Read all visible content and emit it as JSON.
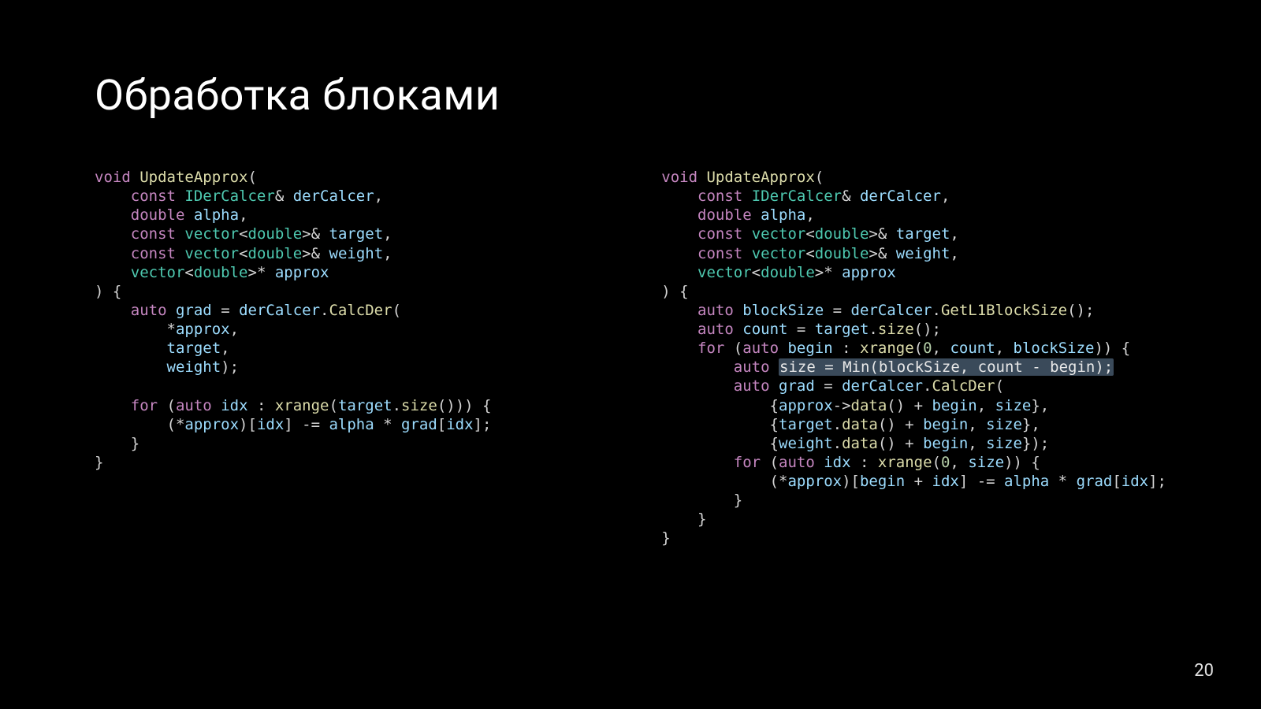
{
  "slide": {
    "title": "Обработка блоками",
    "page_number": "20"
  },
  "code_left": {
    "l1": {
      "kw_void": "void",
      "fn": "UpdateApprox",
      "p": "("
    },
    "l2": {
      "kw_const": "const",
      "type": "IDerCalcer",
      "amp": "&",
      "var": "derCalcer",
      "comma": ","
    },
    "l3": {
      "kw_double": "double",
      "var": "alpha",
      "comma": ","
    },
    "l4": {
      "kw_const": "const",
      "type": "vector",
      "lt": "<",
      "tp": "double",
      "gt": ">",
      "amp": "&",
      "var": "target",
      "comma": ","
    },
    "l5": {
      "kw_const": "const",
      "type": "vector",
      "lt": "<",
      "tp": "double",
      "gt": ">",
      "amp": "&",
      "var": "weight",
      "comma": ","
    },
    "l6": {
      "type": "vector",
      "lt": "<",
      "tp": "double",
      "gt": ">",
      "star": "*",
      "var": "approx"
    },
    "l7": {
      "txt": ") {"
    },
    "l8": {
      "kw_auto": "auto",
      "var": "grad",
      "eq": " = ",
      "obj": "derCalcer",
      "dot": ".",
      "fn": "CalcDer",
      "p": "("
    },
    "l9": {
      "star": "*",
      "var": "approx",
      "comma": ","
    },
    "l10": {
      "var": "target",
      "comma": ","
    },
    "l11": {
      "var": "weight",
      "p": ");"
    },
    "l12": {
      "txt": ""
    },
    "l13": {
      "kw_for": "for",
      "p1": " (",
      "kw_auto": "auto",
      "var": "idx",
      "colon": " : ",
      "fn": "xrange",
      "p2": "(",
      "obj": "target",
      "dot": ".",
      "fn2": "size",
      "p3": "())) {"
    },
    "l14": {
      "p1": "(*",
      "var1": "approx",
      "p2": ")[",
      "var2": "idx",
      "p3": "] -= ",
      "var3": "alpha",
      "p4": " * ",
      "var4": "grad",
      "p5": "[",
      "var5": "idx",
      "p6": "];"
    },
    "l15": {
      "txt": "}"
    },
    "l16": {
      "txt": "}"
    }
  },
  "code_right": {
    "l1": {
      "kw_void": "void",
      "fn": "UpdateApprox",
      "p": "("
    },
    "l2": {
      "kw_const": "const",
      "type": "IDerCalcer",
      "amp": "&",
      "var": "derCalcer",
      "comma": ","
    },
    "l3": {
      "kw_double": "double",
      "var": "alpha",
      "comma": ","
    },
    "l4": {
      "kw_const": "const",
      "type": "vector",
      "lt": "<",
      "tp": "double",
      "gt": ">",
      "amp": "&",
      "var": "target",
      "comma": ","
    },
    "l5": {
      "kw_const": "const",
      "type": "vector",
      "lt": "<",
      "tp": "double",
      "gt": ">",
      "amp": "&",
      "var": "weight",
      "comma": ","
    },
    "l6": {
      "type": "vector",
      "lt": "<",
      "tp": "double",
      "gt": ">",
      "star": "*",
      "var": "approx"
    },
    "l7": {
      "txt": ") {"
    },
    "l8": {
      "kw_auto": "auto",
      "var": "blockSize",
      "eq": " = ",
      "obj": "derCalcer",
      "dot": ".",
      "fn": "GetL1BlockSize",
      "p": "();"
    },
    "l9": {
      "kw_auto": "auto",
      "var": "count",
      "eq": " = ",
      "obj": "target",
      "dot": ".",
      "fn": "size",
      "p": "();"
    },
    "l10": {
      "kw_for": "for",
      "p1": " (",
      "kw_auto": "auto",
      "var": "begin",
      "colon": " : ",
      "fn": "xrange",
      "p2": "(",
      "n0": "0",
      "c1": ", ",
      "v2": "count",
      "c2": ", ",
      "v3": "blockSize",
      "p3": ")) {"
    },
    "l11": {
      "kw_auto": "auto",
      "sp": " ",
      "hl": "size = Min(blockSize, count - begin);"
    },
    "l12": {
      "kw_auto": "auto",
      "var": "grad",
      "eq": " = ",
      "obj": "derCalcer",
      "dot": ".",
      "fn": "CalcDer",
      "p": "("
    },
    "l13": {
      "p1": "{",
      "var1": "approx",
      "arrow": "->",
      "fn": "data",
      "p2": "() + ",
      "var2": "begin",
      "c": ", ",
      "var3": "size",
      "p3": "},"
    },
    "l14": {
      "p1": "{",
      "var1": "target",
      "dot": ".",
      "fn": "data",
      "p2": "() + ",
      "var2": "begin",
      "c": ", ",
      "var3": "size",
      "p3": "},"
    },
    "l15": {
      "p1": "{",
      "var1": "weight",
      "dot": ".",
      "fn": "data",
      "p2": "() + ",
      "var2": "begin",
      "c": ", ",
      "var3": "size",
      "p3": "});"
    },
    "l16": {
      "kw_for": "for",
      "p1": " (",
      "kw_auto": "auto",
      "var": "idx",
      "colon": " : ",
      "fn": "xrange",
      "p2": "(",
      "n0": "0",
      "c": ", ",
      "v2": "size",
      "p3": ")) {"
    },
    "l17": {
      "p1": "(*",
      "v1": "approx",
      "p2": ")[",
      "v2": "begin",
      "p3": " + ",
      "v3": "idx",
      "p4": "] -= ",
      "v4": "alpha",
      "p5": " * ",
      "v5": "grad",
      "p6": "[",
      "v6": "idx",
      "p7": "];"
    },
    "l18": {
      "txt": "}"
    },
    "l19": {
      "txt": "}"
    },
    "l20": {
      "txt": "}"
    }
  }
}
